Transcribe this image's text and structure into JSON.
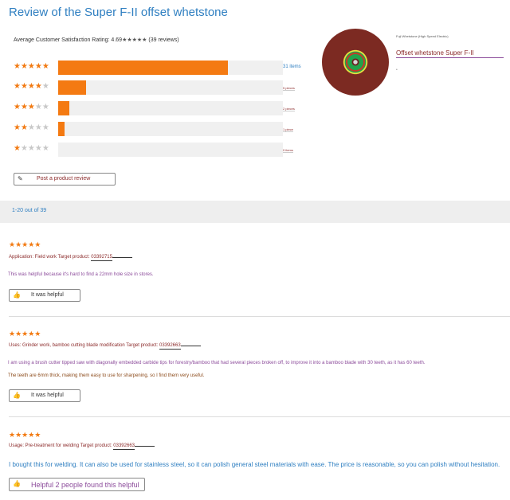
{
  "title": "Review of the Super F-II offset whetstone",
  "summary": {
    "avg_label": "Average Customer Satisfaction Rating: 4.69",
    "avg_stars": "★★★★★",
    "review_count": "(39 reviews)"
  },
  "ratings": [
    {
      "stars": 5,
      "fraction": 0.756,
      "count": "31 items"
    },
    {
      "stars": 4,
      "fraction": 0.124,
      "count": "5 pieces"
    },
    {
      "stars": 3,
      "fraction": 0.049,
      "count": "2 pieces"
    },
    {
      "stars": 2,
      "fraction": 0.028,
      "count": "1 piece"
    },
    {
      "stars": 1,
      "fraction": 0.0,
      "count": "0 items"
    }
  ],
  "post_review_label": "Post a product review",
  "product": {
    "category": "Fuji Whetstone (High Speed Electric)",
    "name": "Offset whetstone Super F-II",
    "dot": "•"
  },
  "pager": {
    "label": "1-20 out of 39"
  },
  "reviews": [
    {
      "stars": "★★★★★",
      "meta": "Application: Field work Target product: ",
      "product_no": "03392715",
      "lines": [
        "This was helpful because it's hard to find a 22mm hole size in stores."
      ],
      "helpful_label": "It was helpful"
    },
    {
      "stars": "★★★★★",
      "meta": "Uses: Grinder work, bamboo cutting blade modification Target product: ",
      "product_no": "03392663",
      "lines": [
        "I am using a brush cutter tipped saw with diagonally embedded carbide tips for forestry/bamboo that had several pieces broken off, to improve it into a bamboo blade with 30 teeth, as it has 60 teeth.",
        "The teeth are 6mm thick, making them easy to use for sharpening, so I find them very useful."
      ],
      "helpful_label": "It was helpful"
    },
    {
      "stars": "★★★★★",
      "meta": "Usage: Pre-treatment for welding Target product: ",
      "product_no": "03392663",
      "lines": [
        "I bought this for welding. It can also be used for stainless steel, so it can polish general steel materials with ease. The price is reasonable, so you can polish without hesitation."
      ],
      "helpful_label": "Helpful 2 people found this helpful"
    }
  ],
  "colors": {
    "accent": "#2f7fc1",
    "star": "#f27a12",
    "bar": "#f47a12"
  },
  "icons": {
    "post": "pencil-icon",
    "helpful": "thumbs-up-icon"
  }
}
